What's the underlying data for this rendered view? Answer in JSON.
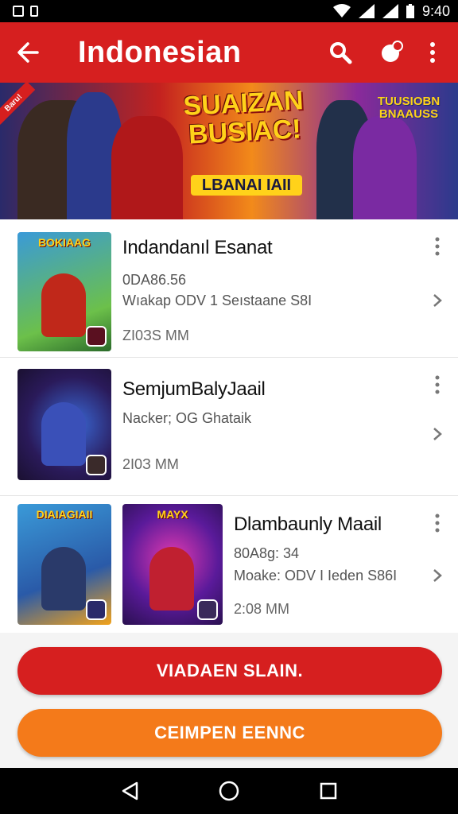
{
  "status_bar": {
    "time": "9:40"
  },
  "app_bar": {
    "title": "Indonesian"
  },
  "banner": {
    "ribbon": "Baru!",
    "headline": "SUAIZAN BUSIAC!",
    "subline": "LBANAI IAII",
    "corner_tag": "TUUSIOBN BNAAUSS"
  },
  "items": [
    {
      "thumb_label": "BOKIAAG",
      "name": "Indandanıl Esanat",
      "meta_1": "0DA86.56",
      "meta_2": "Wıakap ODV 1 Seıstaane S8I",
      "size": "ZI0ЗS MM"
    },
    {
      "thumb_label": "",
      "name": "SemjumBalyJaail",
      "meta_1": "",
      "meta_2": "Nacker; OG Ghataik",
      "size": "2I0З MM"
    },
    {
      "thumb_labels": [
        "DIAIAGIAII",
        "MAYX"
      ],
      "name": "Dlambaunly Maail",
      "meta_1": "80A8g: 34",
      "meta_2": "Moake: ODV I Ieden S86I",
      "size": "2:08 MM"
    }
  ],
  "buttons": {
    "primary": "VIADAEN SLAIN.",
    "secondary": "CEIMPEN EENNC"
  },
  "colors": {
    "accent": "#d61f1f",
    "secondary": "#f47a1a"
  }
}
